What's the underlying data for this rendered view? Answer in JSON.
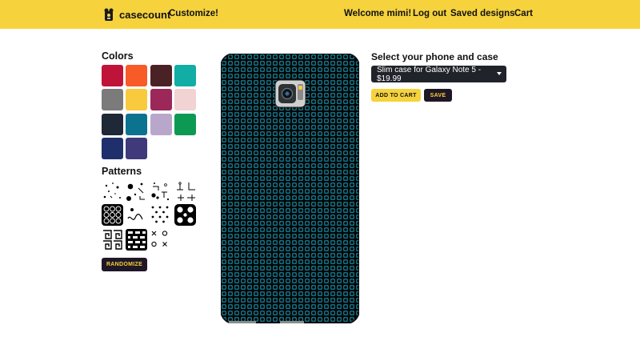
{
  "header": {
    "brand": "casecount",
    "nav": {
      "customize": "Customize!",
      "welcome": "Welcome mimi!",
      "logout": "Log out",
      "saved": "Saved designs",
      "cart": "Cart"
    },
    "background_color": "#f6d23c"
  },
  "colors": {
    "title": "Colors",
    "swatches": [
      "#c0133a",
      "#f85a28",
      "#4a2226",
      "#12ada4",
      "#7b7b7b",
      "#f9c93e",
      "#9c2859",
      "#f1d3d3",
      "#1e2836",
      "#0b7390",
      "#b9a7cb",
      "#0c9a52",
      "#1f2f6c",
      "#3f3a7a"
    ]
  },
  "patterns": {
    "title": "Patterns",
    "tiles": [
      "confetti-dots",
      "circuit-lines",
      "circuit-t",
      "flower-lattice",
      "polka-dots",
      "rounded-circles",
      "greek-key",
      "brick-blocks",
      "x-and-o"
    ],
    "randomize_label": "RANDOMIZE"
  },
  "preview": {
    "pattern_color": "#127285",
    "pattern_shape": "rounded-squares-grid"
  },
  "product": {
    "title": "Select your phone and case",
    "selected_option": "Slim case for Galaxy Note 5 - $19.99",
    "add_to_cart_label": "ADD TO CART",
    "save_label": "SAVE"
  }
}
